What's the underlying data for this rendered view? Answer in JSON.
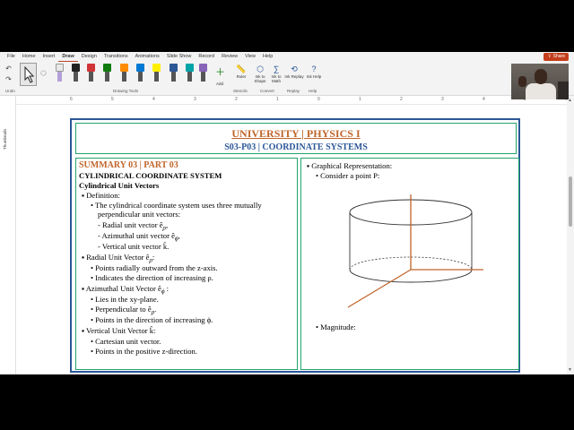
{
  "menu": {
    "tabs": [
      "File",
      "Home",
      "Insert",
      "Draw",
      "Design",
      "Transitions",
      "Animations",
      "Slide Show",
      "Record",
      "Review",
      "View",
      "Help"
    ],
    "active": "Draw",
    "share_label": "Share"
  },
  "ribbon": {
    "groups": [
      "Undo",
      "Drawing Tools",
      "Stencils",
      "Convert",
      "Replay",
      "Help"
    ],
    "pen_colors": [
      "#222222",
      "#d13438",
      "#107c10",
      "#ff8c00",
      "#0078d4",
      "#ffef00",
      "#2b5797",
      "#00a4a6",
      "#8764b8",
      "#555555"
    ],
    "tools": {
      "add": "Add",
      "ruler": "Ruler",
      "ink_to_shape": "Ink to Shape",
      "ink_to_math": "Ink to Math",
      "ink_replay": "Ink Replay",
      "ink_help": "Ink Help"
    }
  },
  "rail": {
    "label": "Thumbnails"
  },
  "ruler": {
    "ticks": [
      "6",
      "5",
      "4",
      "3",
      "2",
      "1",
      "0",
      "1",
      "2",
      "3",
      "4",
      "5",
      "6"
    ]
  },
  "slide": {
    "title": "UNIVERSITY | PHYSICS I",
    "subtitle": "S03-P03 | COORDINATE SYSTEMS",
    "left": {
      "summary": "SUMMARY 03 | PART 03",
      "heading1": "CYLINDRICAL COORDINATE SYSTEM",
      "heading2": "Cylindrical Unit Vectors",
      "lines": [
        "▪  Definition:",
        "•  The cylindrical coordinate system uses three mutually",
        "perpendicular unit vectors:",
        "-  Radial unit vector ê",
        "-  Azimuthal unit vector ê",
        "-  Vertical unit vector k̂.",
        "▪  Radial Unit Vector ê",
        "•  Points radially outward from the z-axis.",
        "•  Indicates the direction of increasing ρ.",
        "▪  Azimuthal Unit Vector ê",
        "•  Lies in the xy-plane.",
        "•  Perpendicular to ê",
        "•  Points in the direction of increasing ϕ.",
        "▪  Vertical Unit Vector k̂:",
        "•  Cartesian unit vector.",
        "•  Points in the positive z-direction."
      ],
      "sub_rho": "ρ",
      "sub_phi": "ϕ"
    },
    "right": {
      "line1": "▪  Graphical Representation:",
      "line2": "•  Consider a point P:",
      "line3": "•  Magnitude:"
    }
  }
}
